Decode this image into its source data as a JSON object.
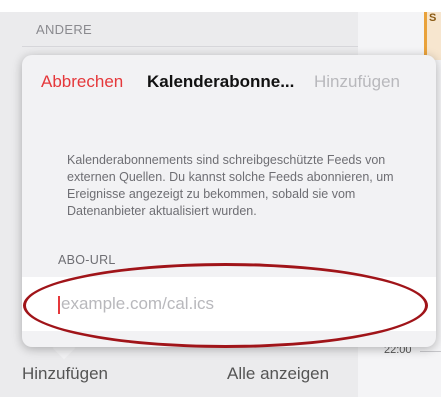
{
  "background": {
    "section_header": "ANDERE",
    "event_stub": "S",
    "time_label": "22:00"
  },
  "dialog": {
    "cancel_label": "Abbrechen",
    "title": "Kalenderabonne...",
    "add_label": "Hinzufügen",
    "description": "Kalenderabonnements sind schreibgeschützte Feeds von externen Quellen. Du kannst solche Feeds abonnieren, um Ereignisse angezeigt zu bekommen, sobald sie vom Datenanbieter aktualisiert wurden.",
    "field_label": "ABO-URL",
    "url_value": "",
    "url_placeholder": "example.com/cal.ics"
  },
  "bottom_bar": {
    "left_label": "Hinzufügen",
    "right_label": "Alle anzeigen"
  },
  "colors": {
    "accent_red": "#e5383b",
    "disabled_gray": "#b8b8bc",
    "annotation_red": "#a01419"
  }
}
